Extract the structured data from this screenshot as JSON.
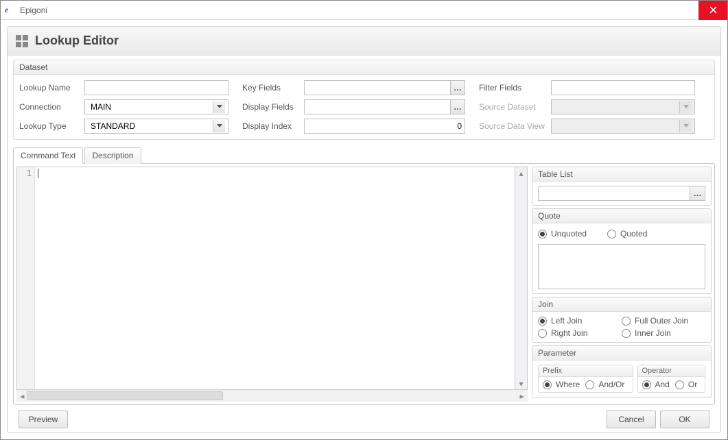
{
  "window": {
    "title": "Epigoni"
  },
  "header": {
    "title": "Lookup Editor"
  },
  "dataset": {
    "group_label": "Dataset",
    "lookup_name": {
      "label": "Lookup Name",
      "value": ""
    },
    "connection": {
      "label": "Connection",
      "value": "MAIN"
    },
    "lookup_type": {
      "label": "Lookup Type",
      "value": "STANDARD"
    },
    "key_fields": {
      "label": "Key Fields",
      "value": ""
    },
    "display_fields": {
      "label": "Display Fields",
      "value": ""
    },
    "display_index": {
      "label": "Display Index",
      "value": "0"
    },
    "filter_fields": {
      "label": "Filter Fields",
      "value": ""
    },
    "source_dataset": {
      "label": "Source Dataset",
      "value": ""
    },
    "source_data_view": {
      "label": "Source Data View",
      "value": ""
    }
  },
  "tabs": {
    "command_text": "Command Text",
    "description": "Description",
    "active": "command_text"
  },
  "editor": {
    "line_number": "1",
    "content": ""
  },
  "side": {
    "table_list": {
      "label": "Table List",
      "value": ""
    },
    "quote": {
      "label": "Quote",
      "unquoted": "Unquoted",
      "quoted": "Quoted",
      "selected": "unquoted"
    },
    "join": {
      "label": "Join",
      "left": "Left Join",
      "right": "Right Join",
      "full": "Full Outer Join",
      "inner": "Inner Join",
      "selected": "left"
    },
    "parameter": {
      "label": "Parameter",
      "prefix": {
        "label": "Prefix",
        "where": "Where",
        "andor": "And/Or",
        "selected": "where"
      },
      "operator": {
        "label": "Operator",
        "and": "And",
        "or": "Or",
        "selected": "and"
      }
    }
  },
  "footer": {
    "preview": "Preview",
    "cancel": "Cancel",
    "ok": "OK"
  }
}
